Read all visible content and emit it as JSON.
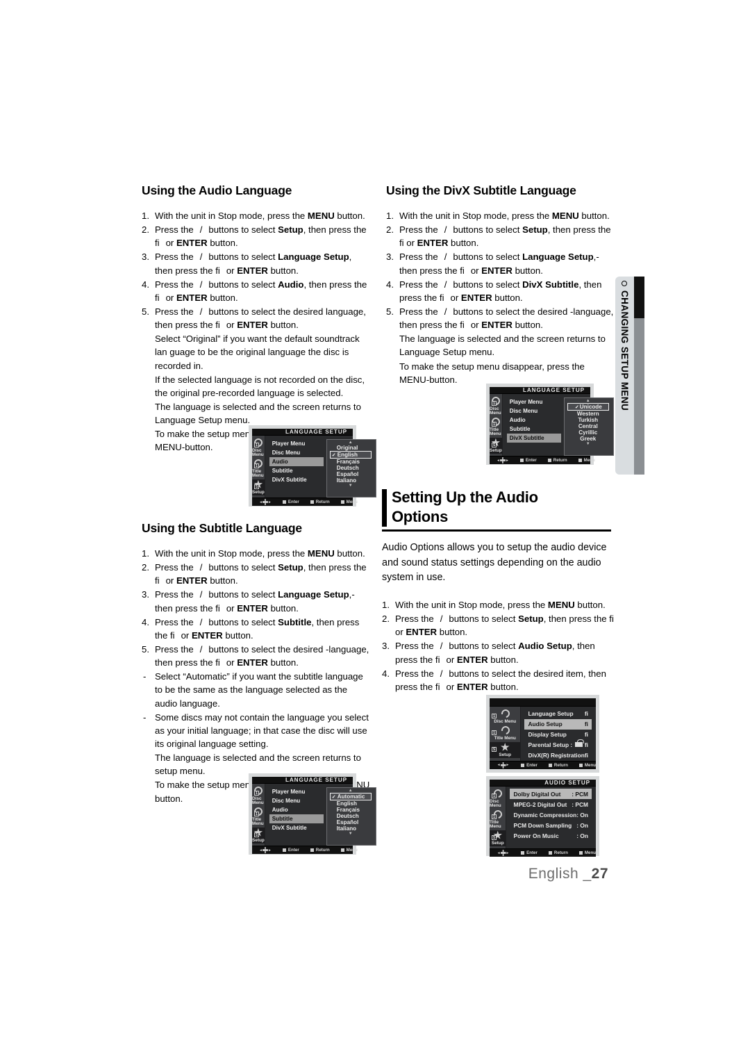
{
  "side_tab": {
    "label": "CHANGING SETUP MENU",
    "bullet": "circle-bullet-icon"
  },
  "footer": {
    "language": "English _",
    "page": "27"
  },
  "sections": {
    "audio_language": {
      "heading": "Using the Audio Language",
      "steps": [
        {
          "num": "1.",
          "text": "With the unit in Stop mode, press the ",
          "bold": "MENU",
          "tail": " button."
        },
        {
          "num": "2.",
          "text": "Press the    /    buttons to select ",
          "bold": "Setup",
          "tail": ", then press the fi  or ENTER button."
        },
        {
          "num": "3.",
          "text": "Press the    /    buttons to select ",
          "bold": "Language Setup",
          "tail": ", then press the fi  or ENTER button."
        },
        {
          "num": "4.",
          "text": "Press the    /    buttons to select ",
          "bold": "Audio",
          "tail": ", then press the fi  or ENTER button."
        },
        {
          "num": "5.",
          "text": "Press the    /    buttons to select the desired language, then press the fi  or ENTER button."
        }
      ],
      "notes": [
        "Select “Original” if you want the default soundtrack lan guage to be the original language the disc is recorded in.",
        "If the selected language is not recorded on the disc, the original pre-recorded language is selected.",
        "The language is selected and the screen returns to Language Setup menu.",
        "To make the setup menu disappear, press the MENU-button."
      ]
    },
    "subtitle_language": {
      "heading": "Using the Subtitle Language",
      "steps": [
        {
          "num": "1.",
          "text": "With the unit in Stop mode, press the ",
          "bold": "MENU",
          "tail": " button."
        },
        {
          "num": "2.",
          "text": "Press the    /    buttons to select ",
          "bold": "Setup",
          "tail": ", then press the fi  or ENTER button."
        },
        {
          "num": "3.",
          "text": "Press the    /    buttons to select ",
          "bold": "Language Setup",
          "tail": ",-then press the fi  or ENTER button."
        },
        {
          "num": "4.",
          "text": "Press the    /    buttons to select ",
          "bold": "Subtitle",
          "tail": ", then press the fi  or ENTER button."
        },
        {
          "num": "5.",
          "text": "Press the    /    buttons to select the desired -language, then press the fi  or ENTER button."
        }
      ],
      "dashes": [
        "Select “Automatic” if you want the subtitle  language to be the same as the language selected as the audio language.",
        "Some discs may not contain the language you select as your initial language; in that case the disc will use its original language setting."
      ],
      "notes": [
        "The language is selected and the screen returns to setup menu.",
        "To make the setup menu disappear, press the MENU button."
      ]
    },
    "divx_subtitle_language": {
      "heading": "Using the DivX Subtitle Language",
      "steps": [
        {
          "num": "1.",
          "text": "With the unit in Stop mode, press the ",
          "bold": "MENU",
          "tail": " button."
        },
        {
          "num": "2.",
          "text": "Press the    /    buttons to select ",
          "bold": "Setup",
          "tail": ", then press the fi  or ENTER button."
        },
        {
          "num": "3.",
          "text": "Press the    /    buttons to select ",
          "bold": "Language Setup",
          "tail": ",-then press the fi  or ENTER button."
        },
        {
          "num": "4.",
          "text": "Press the    /    buttons to select ",
          "bold": "DivX Subtitle",
          "tail": ", then press the fi  or ENTER button."
        },
        {
          "num": "5.",
          "text": "Press the    /    buttons to select the desired -language, then press the fi  or ENTER button."
        }
      ],
      "notes": [
        "The language is selected and the screen returns to Language Setup menu.",
        "To make the setup menu disappear, press the MENU-button."
      ]
    },
    "audio_options": {
      "heading_line1": "Setting Up the Audio",
      "heading_line2": "Options",
      "intro": "Audio Options allows you to setup the audio device and sound status settings depending on the audio system in use.",
      "steps": [
        {
          "num": "1.",
          "text": "With the unit in Stop mode, press the ",
          "bold": "MENU",
          "tail": " button."
        },
        {
          "num": "2.",
          "text": "Press the    /    buttons to select ",
          "bold": "Setup",
          "tail": ", then press the fi  or ENTER button."
        },
        {
          "num": "3.",
          "text": "Press the    /    buttons to select ",
          "bold": "Audio Setup",
          "tail": ", then press the fi  or ENTER button."
        },
        {
          "num": "4.",
          "text": "Press the    /    buttons to select the desired item, then press the fi  or ENTER button."
        }
      ]
    }
  },
  "screens": {
    "sidebar": [
      {
        "label": "Disc Menu",
        "icon": "disc-menu-icon",
        "badge": "1"
      },
      {
        "label": "Title Menu",
        "icon": "title-menu-icon",
        "badge": "1"
      },
      {
        "label": "Setup",
        "icon": "setup-star-icon",
        "badge": "S"
      }
    ],
    "footbar": [
      {
        "icon": "dpad-icon",
        "label": ""
      },
      {
        "icon": "square-icon",
        "label": "Enter"
      },
      {
        "icon": "square-icon",
        "label": "Return"
      },
      {
        "icon": "square-icon",
        "label": "Menu"
      }
    ],
    "language_audio": {
      "title": "LANGUAGE SETUP",
      "menu": [
        "Player Menu",
        "Disc Menu",
        "Audio",
        "Subtitle",
        "DivX Subtitle"
      ],
      "selected_menu": "Audio",
      "options": [
        "Original",
        "English",
        "Français",
        "Deutsch",
        "Español",
        "Italiano"
      ],
      "selected_option": "English",
      "scroll_up": "▲",
      "scroll_down": "▼"
    },
    "language_subtitle": {
      "title": "LANGUAGE SETUP",
      "menu": [
        "Player Menu",
        "Disc Menu",
        "Audio",
        "Subtitle",
        "DivX Subtitle"
      ],
      "selected_menu": "Subtitle",
      "options": [
        "Automatic",
        "English",
        "Français",
        "Deutsch",
        "Español",
        "Italiano"
      ],
      "selected_option": "Automatic",
      "scroll_up": "▲",
      "scroll_down": "▼"
    },
    "language_divx": {
      "title": "LANGUAGE SETUP",
      "menu": [
        "Player Menu",
        "Disc Menu",
        "Audio",
        "Subtitle",
        "DivX Subtitle"
      ],
      "selected_menu": "DivX Subtitle",
      "options": [
        "Unicode",
        "Western",
        "Turkish",
        "Central",
        "Cyrillic",
        "Greek"
      ],
      "selected_option": "Unicode",
      "scroll_up": "▲",
      "scroll_down": "▼"
    },
    "setup_menu": {
      "title": "",
      "rows": [
        {
          "label": "Language Setup",
          "value": "fi"
        },
        {
          "label": "Audio Setup",
          "value": "fi"
        },
        {
          "label": "Display Setup",
          "value": "fi"
        },
        {
          "label": "Parental Setup :",
          "value": "fi",
          "icon": "lock-icon"
        },
        {
          "label": "DivX(R) Registration",
          "value": "fi"
        }
      ],
      "selected": "Audio Setup"
    },
    "audio_setup": {
      "title": "AUDIO SETUP",
      "rows": [
        {
          "label": "Dolby Digital Out",
          "value": ": PCM"
        },
        {
          "label": "MPEG-2 Digital Out",
          "value": ": PCM"
        },
        {
          "label": "Dynamic Compression",
          "value": ": On"
        },
        {
          "label": "PCM Down Sampling",
          "value": ": On"
        },
        {
          "label": "Power On Music",
          "value": ": On"
        }
      ],
      "selected": "Dolby Digital Out"
    }
  }
}
